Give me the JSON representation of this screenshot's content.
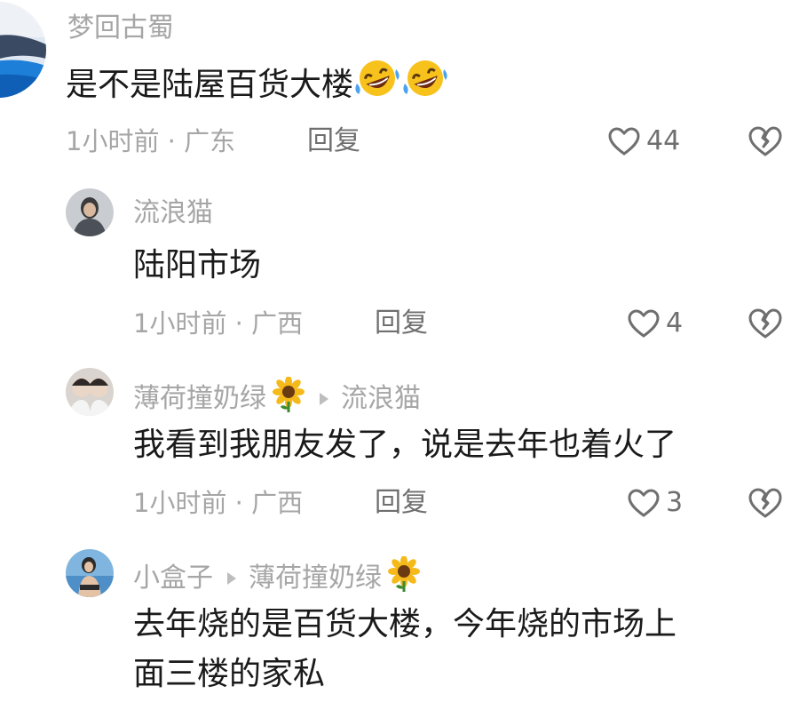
{
  "comment": {
    "username": "梦回古蜀",
    "text": "是不是陆屋百货大楼",
    "emoji": [
      "rolling-on-floor-laughing",
      "rolling-on-floor-laughing"
    ],
    "meta": "1小时前 · 广东",
    "reply_label": "回复",
    "likes": "44"
  },
  "replies": [
    {
      "username": "流浪猫",
      "text": "陆阳市场",
      "meta": "1小时前 · 广西",
      "reply_label": "回复",
      "likes": "4"
    },
    {
      "username": "薄荷撞奶绿",
      "username_emoji": "sunflower",
      "reply_to": "流浪猫",
      "text": "我看到我朋友发了，说是去年也着火了",
      "meta": "1小时前 · 广西",
      "reply_label": "回复",
      "likes": "3"
    },
    {
      "username": "小盒子",
      "reply_to": "薄荷撞奶绿",
      "reply_to_emoji": "sunflower",
      "text_line1": "去年烧的是百货大楼，今年烧的市场上",
      "text_line2": "面三楼的家私"
    }
  ],
  "colors": {
    "username": "#a6a6a6",
    "body": "#1a1a1a",
    "meta": "#a6a6a6",
    "action": "#6f6f6f"
  }
}
